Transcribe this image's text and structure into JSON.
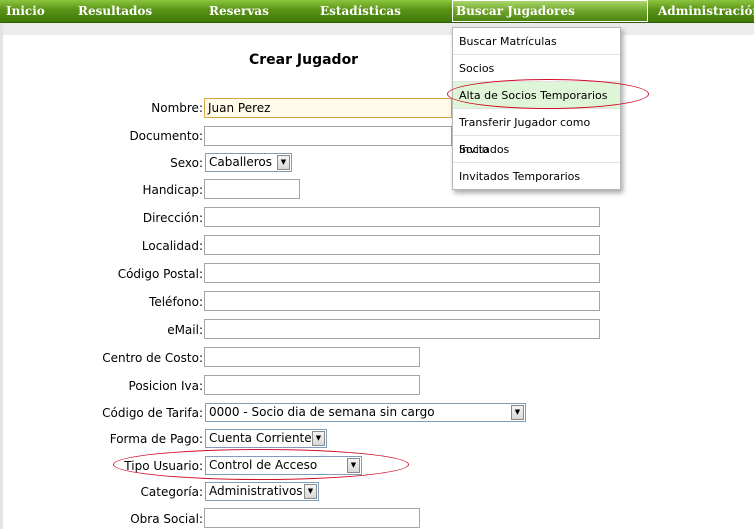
{
  "nav": {
    "items": [
      "Inicio",
      "Resultados",
      "Reservas",
      "Estadísticas",
      "Buscar Jugadores",
      "Administración"
    ],
    "active": "Buscar Jugadores"
  },
  "dropdown": {
    "items": [
      "Buscar Matrículas",
      "Socios",
      "Alta de Socios Temporarios",
      "Transferir Jugador como Socio",
      "Invitados",
      "Invitados Temporarios"
    ],
    "highlighted": "Alta de Socios Temporarios"
  },
  "form": {
    "title": "Crear Jugador",
    "nombre": {
      "label": "Nombre:",
      "value": "Juan Perez"
    },
    "documento": {
      "label": "Documento:",
      "value": ""
    },
    "sexo": {
      "label": "Sexo:",
      "value": "Caballeros"
    },
    "handicap": {
      "label": "Handicap:",
      "value": ""
    },
    "direccion": {
      "label": "Dirección:",
      "value": ""
    },
    "localidad": {
      "label": "Localidad:",
      "value": ""
    },
    "codigo_postal": {
      "label": "Código Postal:",
      "value": ""
    },
    "telefono": {
      "label": "Teléfono:",
      "value": ""
    },
    "email": {
      "label": "eMail:",
      "value": ""
    },
    "centro_costo": {
      "label": "Centro de Costo:",
      "value": ""
    },
    "posicion_iva": {
      "label": "Posicion Iva:",
      "value": ""
    },
    "codigo_tarifa": {
      "label": "Código de Tarifa:",
      "value": "0000 - Socio dia de semana sin cargo"
    },
    "forma_pago": {
      "label": "Forma de Pago:",
      "value": "Cuenta Corriente"
    },
    "tipo_usuario": {
      "label": "Tipo Usuario:",
      "value": "Control de Acceso"
    },
    "categoria": {
      "label": "Categoría:",
      "value": "Administrativos"
    },
    "obra_social": {
      "label": "Obra Social:",
      "value": ""
    }
  },
  "colors": {
    "nav_green": "#5a9216",
    "highlight": "#dff5d7",
    "annotation_red": "#d1102a"
  },
  "icons": {
    "select_arrow": "dropdown-arrow-icon"
  }
}
